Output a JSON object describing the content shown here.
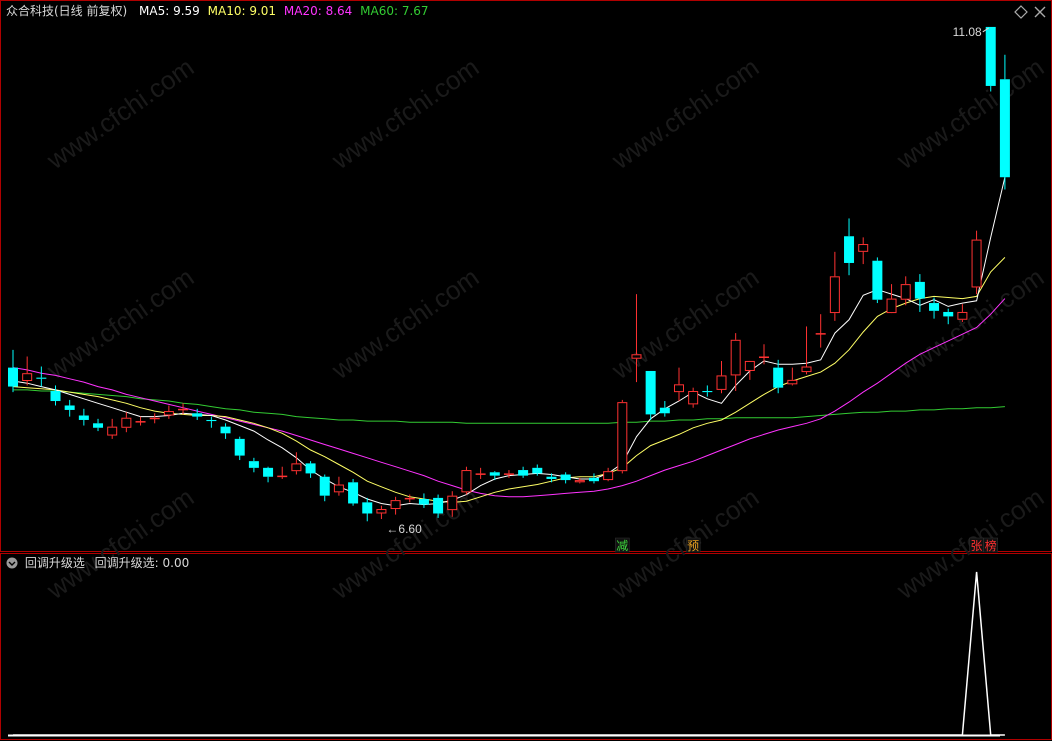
{
  "main_legend": {
    "title": "众合科技(日线 前复权)",
    "ma5": "MA5: 9.59",
    "ma10": "MA10: 9.01",
    "ma20": "MA20: 8.64",
    "ma60": "MA60: 7.67"
  },
  "sub_legend": {
    "name": "回调升级选",
    "value": "回调升级选: 0.00"
  },
  "annotations": {
    "high_label": "11.08",
    "low_label": "6.60"
  },
  "signals": [
    {
      "text": "减",
      "bar": 43,
      "color": "#3cd83c"
    },
    {
      "text": "预",
      "bar": 48,
      "color": "#e8a020"
    },
    {
      "text": "张",
      "bar": 68,
      "color": "#ff3030"
    },
    {
      "text": "榜",
      "bar": 69,
      "color": "#ff3030"
    }
  ],
  "colors": {
    "up": "#ff3232",
    "down": "#00ffff",
    "ma5": "#ffffff",
    "ma10": "#ffff66",
    "ma20": "#ff33ff",
    "ma60": "#33cc33",
    "border": "#b00000",
    "indicator": "#ffffff"
  },
  "chart_data": {
    "type": "candlestick",
    "title": "众合科技(日线 前复权)",
    "price_range": [
      6.4,
      11.25
    ],
    "candles": [
      [
        8.02,
        7.85,
        8.18,
        7.8
      ],
      [
        7.9,
        7.97,
        8.12,
        7.86
      ],
      [
        7.93,
        7.92,
        8.03,
        7.85
      ],
      [
        7.81,
        7.72,
        7.86,
        7.68
      ],
      [
        7.68,
        7.64,
        7.73,
        7.58
      ],
      [
        7.59,
        7.55,
        7.65,
        7.5
      ],
      [
        7.52,
        7.48,
        7.56,
        7.45
      ],
      [
        7.41,
        7.49,
        7.56,
        7.38
      ],
      [
        7.48,
        7.57,
        7.62,
        7.44
      ],
      [
        7.54,
        7.54,
        7.58,
        7.5
      ],
      [
        7.56,
        7.57,
        7.61,
        7.52
      ],
      [
        7.59,
        7.63,
        7.68,
        7.56
      ],
      [
        7.65,
        7.65,
        7.7,
        7.6
      ],
      [
        7.61,
        7.58,
        7.65,
        7.55
      ],
      [
        7.55,
        7.54,
        7.58,
        7.48
      ],
      [
        7.49,
        7.43,
        7.52,
        7.38
      ],
      [
        7.38,
        7.23,
        7.4,
        7.19
      ],
      [
        7.18,
        7.12,
        7.21,
        7.08
      ],
      [
        7.12,
        7.04,
        7.13,
        6.99
      ],
      [
        7.04,
        7.05,
        7.13,
        7.02
      ],
      [
        7.09,
        7.16,
        7.26,
        7.06
      ],
      [
        7.16,
        7.07,
        7.18,
        7.03
      ],
      [
        7.04,
        6.87,
        7.06,
        6.82
      ],
      [
        6.9,
        6.97,
        7.04,
        6.87
      ],
      [
        6.99,
        6.8,
        7.02,
        6.78
      ],
      [
        6.81,
        6.71,
        6.85,
        6.64
      ],
      [
        6.71,
        6.75,
        6.78,
        6.66
      ],
      [
        6.75,
        6.83,
        6.86,
        6.7
      ],
      [
        6.84,
        6.85,
        6.88,
        6.81
      ],
      [
        6.84,
        6.79,
        6.89,
        6.76
      ],
      [
        6.85,
        6.71,
        6.88,
        6.67
      ],
      [
        6.74,
        6.87,
        6.91,
        6.68
      ],
      [
        6.9,
        7.1,
        7.13,
        6.88
      ],
      [
        7.07,
        7.07,
        7.12,
        7.02
      ],
      [
        7.08,
        7.05,
        7.09,
        7.01
      ],
      [
        7.06,
        7.07,
        7.1,
        7.03
      ],
      [
        7.1,
        7.05,
        7.13,
        7.03
      ],
      [
        7.12,
        7.07,
        7.15,
        7.05
      ],
      [
        7.04,
        7.02,
        7.07,
        6.99
      ],
      [
        7.06,
        7.01,
        7.08,
        6.98
      ],
      [
        6.99,
        7.01,
        7.03,
        6.98
      ],
      [
        7.03,
        7.0,
        7.07,
        6.98
      ],
      [
        7.01,
        7.09,
        7.12,
        7.0
      ],
      [
        7.09,
        7.71,
        7.73,
        7.07
      ],
      [
        8.1,
        8.14,
        8.68,
        7.89
      ],
      [
        7.99,
        7.6,
        7.99,
        7.55
      ],
      [
        7.66,
        7.61,
        7.72,
        7.58
      ],
      [
        7.8,
        7.87,
        8.02,
        7.72
      ],
      [
        7.69,
        7.81,
        7.84,
        7.66
      ],
      [
        7.81,
        7.8,
        7.86,
        7.76
      ],
      [
        7.82,
        7.95,
        8.08,
        7.79
      ],
      [
        7.95,
        8.27,
        8.33,
        7.81
      ],
      [
        7.99,
        8.08,
        8.04,
        7.91
      ],
      [
        8.11,
        8.12,
        8.23,
        8.05
      ],
      [
        8.02,
        7.84,
        8.09,
        7.79
      ],
      [
        7.87,
        7.91,
        8.02,
        7.86
      ],
      [
        7.98,
        8.03,
        8.39,
        7.96
      ],
      [
        8.33,
        8.33,
        8.5,
        8.2
      ],
      [
        8.51,
        8.84,
        9.06,
        8.44
      ],
      [
        9.2,
        8.96,
        9.36,
        8.85
      ],
      [
        9.06,
        9.13,
        9.19,
        8.95
      ],
      [
        8.98,
        8.63,
        9.01,
        8.6
      ],
      [
        8.51,
        8.64,
        8.77,
        8.56
      ],
      [
        8.63,
        8.77,
        8.84,
        8.58
      ],
      [
        8.79,
        8.64,
        8.86,
        8.52
      ],
      [
        8.6,
        8.53,
        8.65,
        8.46
      ],
      [
        8.52,
        8.48,
        8.55,
        8.41
      ],
      [
        8.45,
        8.52,
        8.59,
        8.43
      ],
      [
        8.74,
        9.17,
        9.25,
        8.68
      ],
      [
        11.08,
        10.55,
        11.08,
        10.5
      ],
      [
        10.61,
        9.73,
        10.83,
        9.62
      ]
    ],
    "series": [
      {
        "name": "MA5",
        "values": [
          7.9,
          7.88,
          7.85,
          7.82,
          7.78,
          7.74,
          7.7,
          7.66,
          7.62,
          7.58,
          7.58,
          7.59,
          7.61,
          7.6,
          7.59,
          7.55,
          7.5,
          7.45,
          7.37,
          7.3,
          7.21,
          7.1,
          7.02,
          6.95,
          6.9,
          6.84,
          6.8,
          6.78,
          6.8,
          6.79,
          6.8,
          6.83,
          6.88,
          6.96,
          7.02,
          7.05,
          7.06,
          7.07,
          7.06,
          7.04,
          7.02,
          7.02,
          7.07,
          7.16,
          7.4,
          7.56,
          7.65,
          7.72,
          7.8,
          7.74,
          7.7,
          7.86,
          7.99,
          8.08,
          8.05,
          8.05,
          8.06,
          8.09,
          8.33,
          8.45,
          8.67,
          8.72,
          8.68,
          8.64,
          8.58,
          8.63,
          8.57,
          8.6,
          8.62,
          9.19,
          9.73
        ]
      },
      {
        "name": "MA10",
        "values": [
          7.85,
          7.84,
          7.83,
          7.82,
          7.8,
          7.78,
          7.76,
          7.73,
          7.7,
          7.66,
          7.63,
          7.61,
          7.6,
          7.59,
          7.59,
          7.58,
          7.55,
          7.52,
          7.48,
          7.43,
          7.36,
          7.28,
          7.22,
          7.15,
          7.08,
          7.0,
          6.95,
          6.9,
          6.86,
          6.84,
          6.82,
          6.81,
          6.82,
          6.86,
          6.9,
          6.93,
          6.95,
          6.97,
          7.0,
          7.03,
          7.04,
          7.04,
          7.07,
          7.12,
          7.23,
          7.32,
          7.37,
          7.42,
          7.48,
          7.52,
          7.55,
          7.62,
          7.7,
          7.78,
          7.85,
          7.9,
          7.94,
          7.98,
          8.06,
          8.18,
          8.34,
          8.48,
          8.55,
          8.6,
          8.64,
          8.66,
          8.65,
          8.64,
          8.66,
          8.88,
          9.01
        ]
      },
      {
        "name": "MA20",
        "values": [
          8.02,
          8.0,
          7.97,
          7.95,
          7.92,
          7.89,
          7.85,
          7.82,
          7.78,
          7.75,
          7.72,
          7.69,
          7.66,
          7.63,
          7.6,
          7.57,
          7.54,
          7.51,
          7.48,
          7.45,
          7.41,
          7.37,
          7.33,
          7.29,
          7.25,
          7.21,
          7.17,
          7.13,
          7.09,
          7.05,
          7.0,
          6.96,
          6.92,
          6.89,
          6.87,
          6.86,
          6.86,
          6.87,
          6.88,
          6.89,
          6.9,
          6.91,
          6.93,
          6.96,
          7.0,
          7.05,
          7.1,
          7.14,
          7.18,
          7.23,
          7.28,
          7.33,
          7.38,
          7.42,
          7.46,
          7.49,
          7.52,
          7.56,
          7.63,
          7.71,
          7.8,
          7.88,
          7.97,
          8.06,
          8.14,
          8.2,
          8.26,
          8.32,
          8.38,
          8.5,
          8.64
        ]
      },
      {
        "name": "MA60",
        "values": [
          7.82,
          7.82,
          7.81,
          7.81,
          7.8,
          7.79,
          7.78,
          7.77,
          7.76,
          7.74,
          7.73,
          7.72,
          7.7,
          7.69,
          7.67,
          7.65,
          7.64,
          7.62,
          7.61,
          7.6,
          7.58,
          7.57,
          7.56,
          7.55,
          7.55,
          7.54,
          7.54,
          7.54,
          7.53,
          7.53,
          7.53,
          7.53,
          7.52,
          7.52,
          7.52,
          7.52,
          7.52,
          7.52,
          7.52,
          7.52,
          7.52,
          7.52,
          7.52,
          7.53,
          7.53,
          7.54,
          7.54,
          7.55,
          7.55,
          7.56,
          7.56,
          7.57,
          7.57,
          7.57,
          7.57,
          7.57,
          7.58,
          7.59,
          7.6,
          7.61,
          7.62,
          7.62,
          7.63,
          7.63,
          7.64,
          7.64,
          7.65,
          7.65,
          7.66,
          7.66,
          7.67
        ]
      }
    ],
    "indicator": {
      "name": "回调升级选",
      "range": [
        0,
        1
      ],
      "values": [
        0,
        0,
        0,
        0,
        0,
        0,
        0,
        0,
        0,
        0,
        0,
        0,
        0,
        0,
        0,
        0,
        0,
        0,
        0,
        0,
        0,
        0,
        0,
        0,
        0,
        0,
        0,
        0,
        0,
        0,
        0,
        0,
        0,
        0,
        0,
        0,
        0,
        0,
        0,
        0,
        0,
        0,
        0,
        0,
        0,
        0,
        0,
        0,
        0,
        0,
        0,
        0,
        0,
        0,
        0,
        0,
        0,
        0,
        0,
        0,
        0,
        0,
        0,
        0,
        0,
        0,
        0,
        0,
        1,
        0,
        0
      ]
    }
  }
}
